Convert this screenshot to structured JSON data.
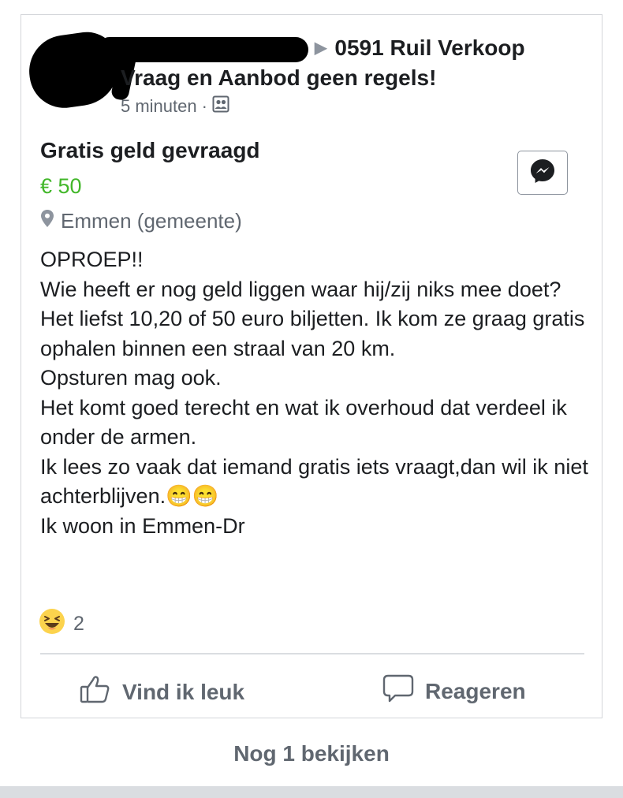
{
  "post": {
    "group_name_line1": "0591 Ruil Verkoop",
    "group_name_line2": "Vraag en Aanbod geen regels!",
    "time": "5 minuten",
    "separator": "·",
    "audience_icon": "group-audience-icon"
  },
  "listing": {
    "title": "Gratis geld gevraagd",
    "price": "€ 50",
    "location": "Emmen (gemeente)",
    "location_icon": "location-pin-icon",
    "messenger_icon": "messenger-icon"
  },
  "body_text": "OPROEP!!\nWie heeft er nog geld liggen waar hij/zij niks mee doet? Het liefst 10,20 of 50 euro biljetten. Ik kom ze graag gratis ophalen binnen een straal van 20 km.\nOpsturen mag ook.\nHet komt goed terecht en wat ik overhoud dat verdeel ik onder de armen.\nIk lees zo vaak dat iemand gratis iets vraagt,dan wil ik niet achterblijven.😁😁\nIk woon in Emmen-Dr",
  "reactions": {
    "icon": "haha-reaction-icon",
    "count": "2"
  },
  "actions": {
    "like_label": "Vind ik leuk",
    "comment_label": "Reageren"
  },
  "footer": {
    "more_label": "Nog 1 bekijken"
  },
  "colors": {
    "price": "#42b72a",
    "secondary_text": "#606770",
    "border": "#d4d6da"
  }
}
